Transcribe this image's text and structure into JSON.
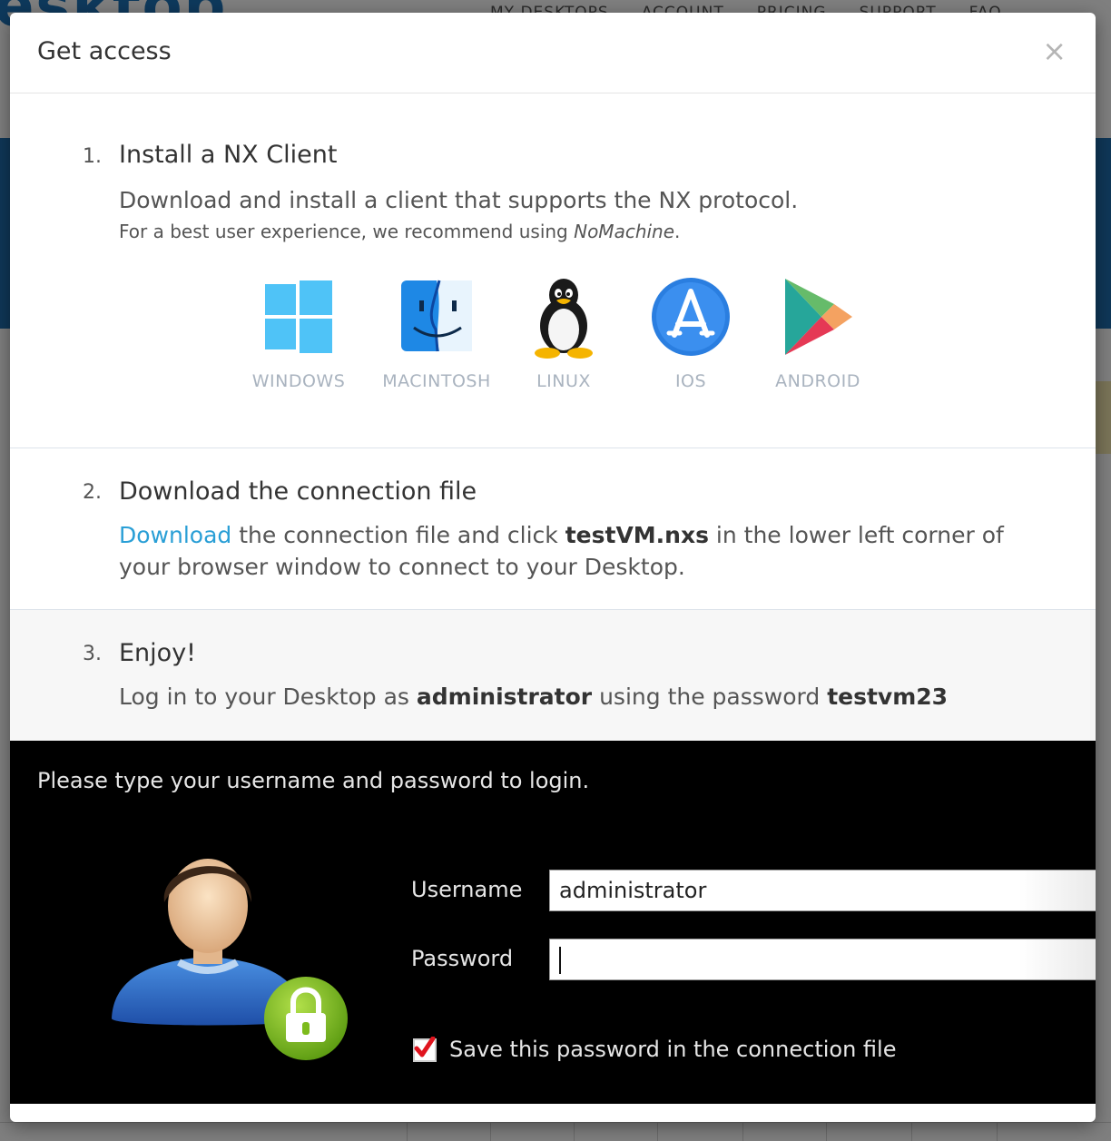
{
  "background": {
    "logo": "esktop",
    "nav": [
      "MY DESKTOPS",
      "ACCOUNT",
      "PRICING",
      "SUPPORT",
      "FAQ"
    ]
  },
  "modal": {
    "title": "Get access",
    "close_label": "×"
  },
  "step1": {
    "number": "1.",
    "title": "Install a NX Client",
    "text": "Download and install a client that supports the NX protocol.",
    "note_prefix": "For a best user experience, we recommend using ",
    "note_em": "NoMachine",
    "note_suffix": ".",
    "platforms": [
      {
        "label": "WINDOWS",
        "icon": "windows-icon"
      },
      {
        "label": "MACINTOSH",
        "icon": "finder-icon"
      },
      {
        "label": "LINUX",
        "icon": "tux-icon"
      },
      {
        "label": "IOS",
        "icon": "app-store-icon"
      },
      {
        "label": "ANDROID",
        "icon": "google-play-icon"
      }
    ]
  },
  "step2": {
    "number": "2.",
    "title": "Download the connection file",
    "link": "Download",
    "text_a": " the connection file and click ",
    "filename": "testVM.nxs",
    "text_b": " in the lower left corner of your browser window to connect to your Desktop."
  },
  "step3": {
    "number": "3.",
    "title": "Enjoy!",
    "text_a": "Log in to your Desktop as ",
    "username": "administrator",
    "text_b": " using the password ",
    "password": "testvm23"
  },
  "login_screen": {
    "prompt": "Please type your username and password to login.",
    "username_label": "Username",
    "username_value": "administrator",
    "password_label": "Password",
    "password_value": "",
    "save_password_checked": true,
    "save_password_label": "Save this password in the connection file"
  },
  "colors": {
    "link": "#2a9fd6",
    "platform_label": "#a9b3bf",
    "check": "#e0141e",
    "lock_badge": "#7dbb1c"
  }
}
